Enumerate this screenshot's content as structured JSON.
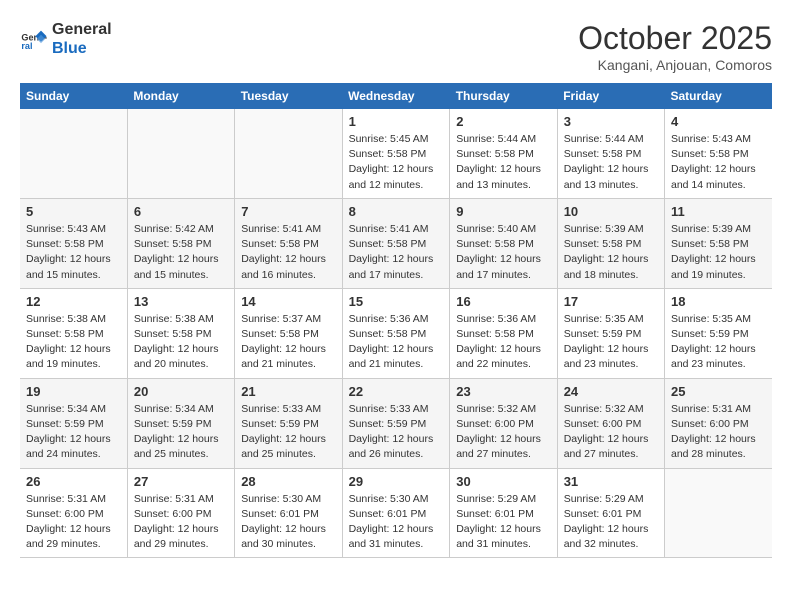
{
  "header": {
    "logo_line1": "General",
    "logo_line2": "Blue",
    "month": "October 2025",
    "location": "Kangani, Anjouan, Comoros"
  },
  "weekdays": [
    "Sunday",
    "Monday",
    "Tuesday",
    "Wednesday",
    "Thursday",
    "Friday",
    "Saturday"
  ],
  "weeks": [
    [
      {
        "day": "",
        "info": ""
      },
      {
        "day": "",
        "info": ""
      },
      {
        "day": "",
        "info": ""
      },
      {
        "day": "1",
        "info": "Sunrise: 5:45 AM\nSunset: 5:58 PM\nDaylight: 12 hours\nand 12 minutes."
      },
      {
        "day": "2",
        "info": "Sunrise: 5:44 AM\nSunset: 5:58 PM\nDaylight: 12 hours\nand 13 minutes."
      },
      {
        "day": "3",
        "info": "Sunrise: 5:44 AM\nSunset: 5:58 PM\nDaylight: 12 hours\nand 13 minutes."
      },
      {
        "day": "4",
        "info": "Sunrise: 5:43 AM\nSunset: 5:58 PM\nDaylight: 12 hours\nand 14 minutes."
      }
    ],
    [
      {
        "day": "5",
        "info": "Sunrise: 5:43 AM\nSunset: 5:58 PM\nDaylight: 12 hours\nand 15 minutes."
      },
      {
        "day": "6",
        "info": "Sunrise: 5:42 AM\nSunset: 5:58 PM\nDaylight: 12 hours\nand 15 minutes."
      },
      {
        "day": "7",
        "info": "Sunrise: 5:41 AM\nSunset: 5:58 PM\nDaylight: 12 hours\nand 16 minutes."
      },
      {
        "day": "8",
        "info": "Sunrise: 5:41 AM\nSunset: 5:58 PM\nDaylight: 12 hours\nand 17 minutes."
      },
      {
        "day": "9",
        "info": "Sunrise: 5:40 AM\nSunset: 5:58 PM\nDaylight: 12 hours\nand 17 minutes."
      },
      {
        "day": "10",
        "info": "Sunrise: 5:39 AM\nSunset: 5:58 PM\nDaylight: 12 hours\nand 18 minutes."
      },
      {
        "day": "11",
        "info": "Sunrise: 5:39 AM\nSunset: 5:58 PM\nDaylight: 12 hours\nand 19 minutes."
      }
    ],
    [
      {
        "day": "12",
        "info": "Sunrise: 5:38 AM\nSunset: 5:58 PM\nDaylight: 12 hours\nand 19 minutes."
      },
      {
        "day": "13",
        "info": "Sunrise: 5:38 AM\nSunset: 5:58 PM\nDaylight: 12 hours\nand 20 minutes."
      },
      {
        "day": "14",
        "info": "Sunrise: 5:37 AM\nSunset: 5:58 PM\nDaylight: 12 hours\nand 21 minutes."
      },
      {
        "day": "15",
        "info": "Sunrise: 5:36 AM\nSunset: 5:58 PM\nDaylight: 12 hours\nand 21 minutes."
      },
      {
        "day": "16",
        "info": "Sunrise: 5:36 AM\nSunset: 5:58 PM\nDaylight: 12 hours\nand 22 minutes."
      },
      {
        "day": "17",
        "info": "Sunrise: 5:35 AM\nSunset: 5:59 PM\nDaylight: 12 hours\nand 23 minutes."
      },
      {
        "day": "18",
        "info": "Sunrise: 5:35 AM\nSunset: 5:59 PM\nDaylight: 12 hours\nand 23 minutes."
      }
    ],
    [
      {
        "day": "19",
        "info": "Sunrise: 5:34 AM\nSunset: 5:59 PM\nDaylight: 12 hours\nand 24 minutes."
      },
      {
        "day": "20",
        "info": "Sunrise: 5:34 AM\nSunset: 5:59 PM\nDaylight: 12 hours\nand 25 minutes."
      },
      {
        "day": "21",
        "info": "Sunrise: 5:33 AM\nSunset: 5:59 PM\nDaylight: 12 hours\nand 25 minutes."
      },
      {
        "day": "22",
        "info": "Sunrise: 5:33 AM\nSunset: 5:59 PM\nDaylight: 12 hours\nand 26 minutes."
      },
      {
        "day": "23",
        "info": "Sunrise: 5:32 AM\nSunset: 6:00 PM\nDaylight: 12 hours\nand 27 minutes."
      },
      {
        "day": "24",
        "info": "Sunrise: 5:32 AM\nSunset: 6:00 PM\nDaylight: 12 hours\nand 27 minutes."
      },
      {
        "day": "25",
        "info": "Sunrise: 5:31 AM\nSunset: 6:00 PM\nDaylight: 12 hours\nand 28 minutes."
      }
    ],
    [
      {
        "day": "26",
        "info": "Sunrise: 5:31 AM\nSunset: 6:00 PM\nDaylight: 12 hours\nand 29 minutes."
      },
      {
        "day": "27",
        "info": "Sunrise: 5:31 AM\nSunset: 6:00 PM\nDaylight: 12 hours\nand 29 minutes."
      },
      {
        "day": "28",
        "info": "Sunrise: 5:30 AM\nSunset: 6:01 PM\nDaylight: 12 hours\nand 30 minutes."
      },
      {
        "day": "29",
        "info": "Sunrise: 5:30 AM\nSunset: 6:01 PM\nDaylight: 12 hours\nand 31 minutes."
      },
      {
        "day": "30",
        "info": "Sunrise: 5:29 AM\nSunset: 6:01 PM\nDaylight: 12 hours\nand 31 minutes."
      },
      {
        "day": "31",
        "info": "Sunrise: 5:29 AM\nSunset: 6:01 PM\nDaylight: 12 hours\nand 32 minutes."
      },
      {
        "day": "",
        "info": ""
      }
    ]
  ]
}
